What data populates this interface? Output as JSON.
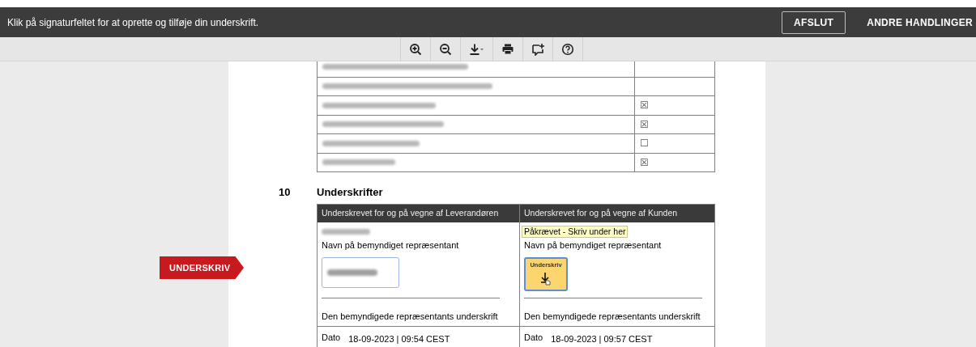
{
  "top_bar": {
    "message": "Klik på signaturfeltet for at oprette og tilføje din underskrift.",
    "buttons": [
      {
        "label": "AFSLUT",
        "kind": "outlined"
      },
      {
        "label": "ANDRE HANDLINGER",
        "kind": "plain"
      }
    ]
  },
  "toolbar": {
    "tools": [
      {
        "kind": "zoom-in"
      },
      {
        "kind": "zoom-out"
      },
      {
        "kind": "download"
      },
      {
        "kind": "print"
      },
      {
        "kind": "comment"
      },
      {
        "kind": "help"
      }
    ]
  },
  "appendix_rows": [
    {
      "kind": "empty"
    },
    {
      "kind": "empty"
    },
    {
      "kind": "marked",
      "mark": "☒"
    },
    {
      "kind": "marked",
      "mark": "☒"
    },
    {
      "kind": "marked",
      "mark": "☐"
    },
    {
      "kind": "marked",
      "mark": "☒"
    }
  ],
  "section": {
    "number": "10",
    "title": "Underskrifter"
  },
  "side_tag": "UNDERSKRIV",
  "signature_table": {
    "columns": [
      {
        "header": "Underskrevet for og på vegne af Leverandøren",
        "name_label": "Navn på bemyndiget repræsentant",
        "kind": "signed",
        "signature_label": "Den bemyndigede repræsentants underskrift",
        "date_label": "Dato",
        "date": "18-09-2023 | 09:54 CEST"
      },
      {
        "header": "Underskrevet for og på vegne af Kunden",
        "name_label": "Navn på bemyndiget repræsentant",
        "kind": "pending",
        "tooltip": "Påkrævet - Skriv under her",
        "sign_button": "Underskriv",
        "signature_label": "Den bemyndigede repræsentants underskrift",
        "date_label": "Dato",
        "date": "18-09-2023 | 09:57 CEST"
      }
    ]
  }
}
